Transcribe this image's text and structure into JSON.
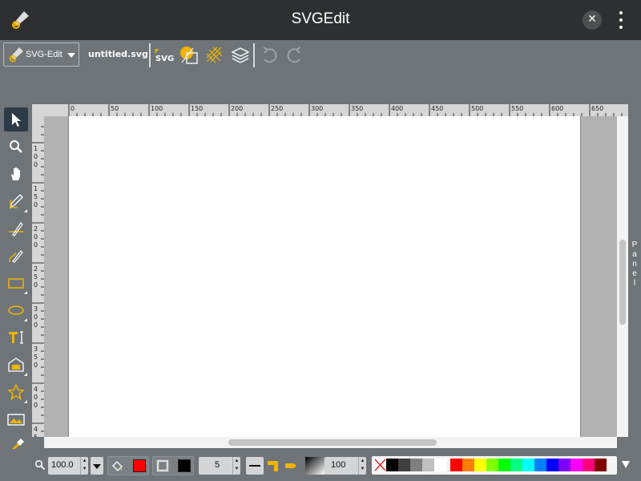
{
  "titlebar": {
    "title": "SVGEdit",
    "close_glyph": "✕"
  },
  "toolbar": {
    "main_menu_label": "SVG-Edit",
    "filename": "untitled.svg",
    "source_button_label": "SVG",
    "icons": [
      "svg-source-icon",
      "wireframe-icon",
      "grid-icon",
      "layers-icon",
      "undo-icon",
      "redo-icon"
    ]
  },
  "tools": [
    {
      "name": "select-tool",
      "icon": "pointer-icon",
      "selected": true
    },
    {
      "name": "zoom-tool",
      "icon": "magnifier-icon"
    },
    {
      "name": "pan-tool",
      "icon": "hand-icon"
    },
    {
      "name": "pencil-tool",
      "icon": "pencil-icon",
      "flyout": true
    },
    {
      "name": "line-tool",
      "icon": "line-icon"
    },
    {
      "name": "path-tool",
      "icon": "path-icon"
    },
    {
      "name": "rect-tool",
      "icon": "rectangle-icon",
      "flyout": true
    },
    {
      "name": "ellipse-tool",
      "icon": "ellipse-icon",
      "flyout": true
    },
    {
      "name": "text-tool",
      "icon": "text-icon"
    },
    {
      "name": "image-tool",
      "icon": "image-icon",
      "flyout": true
    },
    {
      "name": "star-tool",
      "icon": "star-icon",
      "flyout": true
    },
    {
      "name": "image-insert-tool",
      "icon": "picture-icon"
    },
    {
      "name": "eyedropper-tool",
      "icon": "eyedropper-icon"
    }
  ],
  "rulers": {
    "horizontal_labels": [
      "0",
      "50",
      "100",
      "150",
      "200",
      "250",
      "300",
      "350",
      "400",
      "450",
      "500",
      "550",
      "600",
      "650"
    ],
    "vertical_labels": [
      "100",
      "150",
      "200",
      "250",
      "300",
      "350",
      "400",
      "450"
    ]
  },
  "panel_tab": {
    "letters": [
      "P",
      "a",
      "n",
      "e",
      "l"
    ]
  },
  "bottombar": {
    "zoom_value": "100.0",
    "stroke_width": "5",
    "opacity": "100",
    "fill_color": "#ff0000",
    "stroke_color": "#000000"
  },
  "palette": [
    "none",
    "#000000",
    "#3f3f3f",
    "#7f7f7f",
    "#bfbfbf",
    "#ffffff",
    "#ff0000",
    "#ff7f00",
    "#ffff00",
    "#7fff00",
    "#00ff00",
    "#00ff7f",
    "#00ffff",
    "#007fff",
    "#0000ff",
    "#7f00ff",
    "#ff00ff",
    "#ff007f",
    "#7f0000"
  ]
}
